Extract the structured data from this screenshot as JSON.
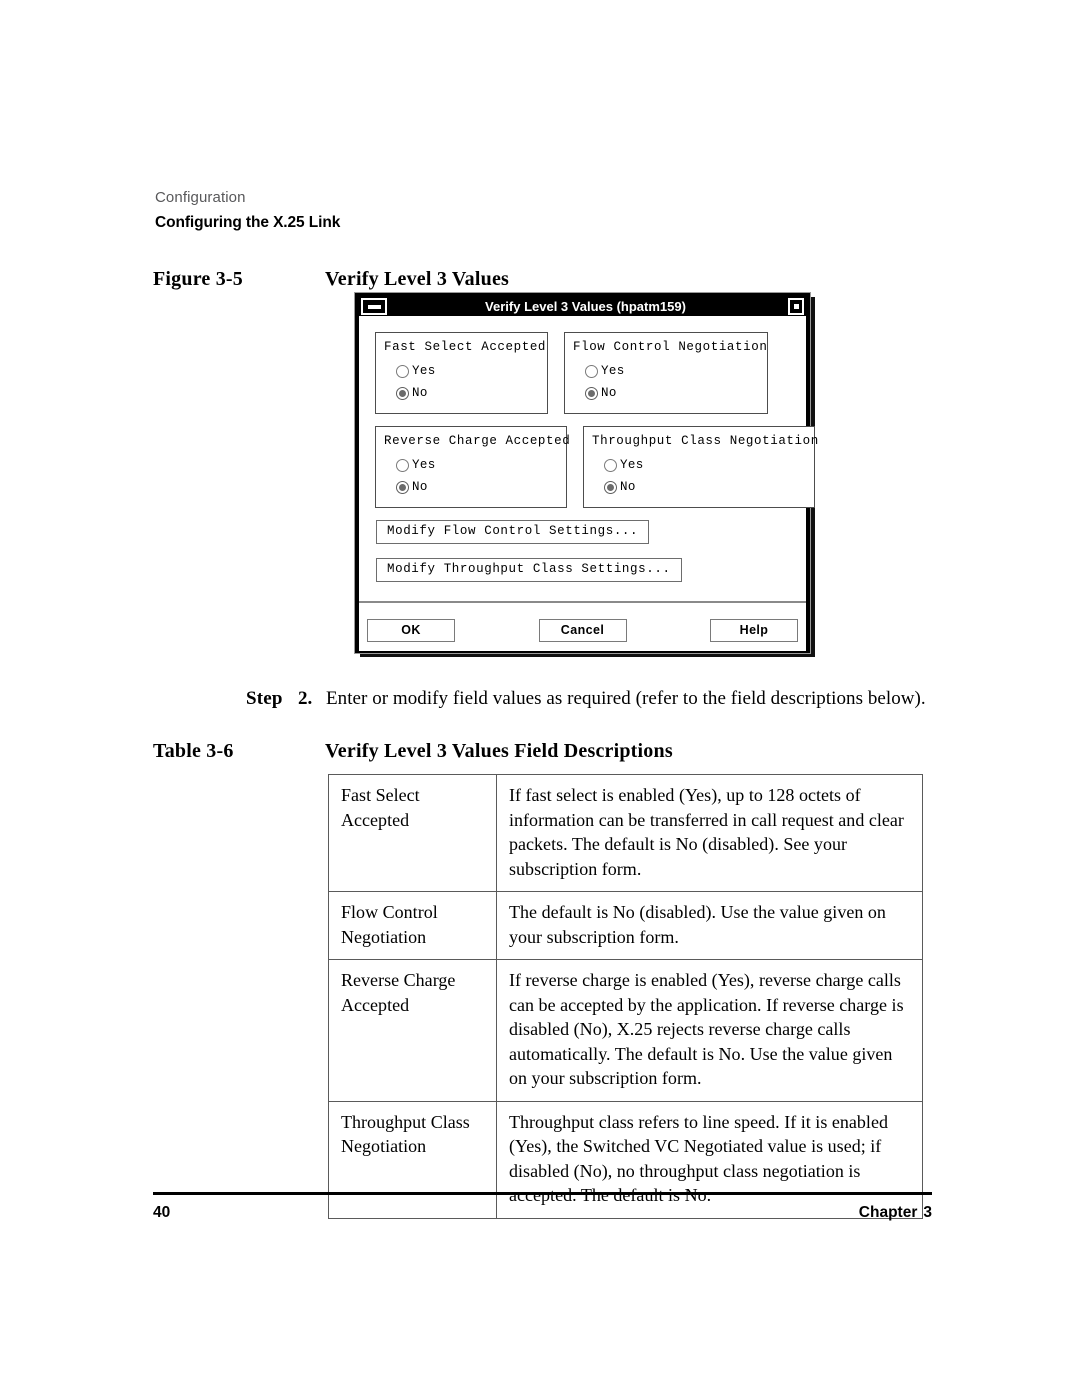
{
  "page": {
    "running_head_chapter": "Configuration",
    "running_head_section": "Configuring the X.25 Link",
    "page_number": "40",
    "footer_chapter_label": "Chapter",
    "footer_chapter_number": "3"
  },
  "figure": {
    "label": "Figure 3-5",
    "title": "Verify Level 3 Values"
  },
  "dialog": {
    "title": "Verify Level 3 Values (hpatm159)",
    "minimize_icon": "minimize-icon",
    "maximize_icon": "maximize-icon",
    "groups": [
      {
        "label": "Fast Select Accepted",
        "options": [
          {
            "label": "Yes",
            "selected": false
          },
          {
            "label": "No",
            "selected": true
          }
        ]
      },
      {
        "label": "Flow Control Negotiation",
        "options": [
          {
            "label": "Yes",
            "selected": false
          },
          {
            "label": "No",
            "selected": true
          }
        ]
      },
      {
        "label": "Reverse Charge Accepted",
        "options": [
          {
            "label": "Yes",
            "selected": false
          },
          {
            "label": "No",
            "selected": true
          }
        ]
      },
      {
        "label": "Throughput Class Negotiation",
        "options": [
          {
            "label": "Yes",
            "selected": false
          },
          {
            "label": "No",
            "selected": true
          }
        ]
      }
    ],
    "modify_flow_button": "Modify Flow Control Settings...",
    "modify_throughput_button": "Modify Throughput Class Settings...",
    "ok_button": "OK",
    "cancel_button": "Cancel",
    "help_button": "Help"
  },
  "step": {
    "word": "Step",
    "number": "2.",
    "text": "Enter or modify field values as required (refer to the field descriptions below)."
  },
  "table": {
    "label": "Table 3-6",
    "title": "Verify Level 3 Values Field Descriptions",
    "rows": [
      {
        "name": "Fast Select Accepted",
        "description": "If fast select is enabled (Yes), up to 128 octets of information can be transferred in call request and clear packets. The default is No (disabled). See your subscription form."
      },
      {
        "name": "Flow Control Negotiation",
        "description": "The default is No (disabled). Use the value given on your subscription form."
      },
      {
        "name": "Reverse Charge Accepted",
        "description": "If reverse charge is enabled (Yes), reverse charge calls can be accepted by the application. If reverse charge is disabled (No), X.25 rejects reverse charge calls automatically. The default is No. Use the value given on your subscription form."
      },
      {
        "name": "Throughput Class Negotiation",
        "description": "Throughput class refers to line speed. If it is enabled (Yes), the Switched VC Negotiated value is used; if disabled (No), no throughput class negotiation is accepted. The default is No."
      }
    ]
  }
}
